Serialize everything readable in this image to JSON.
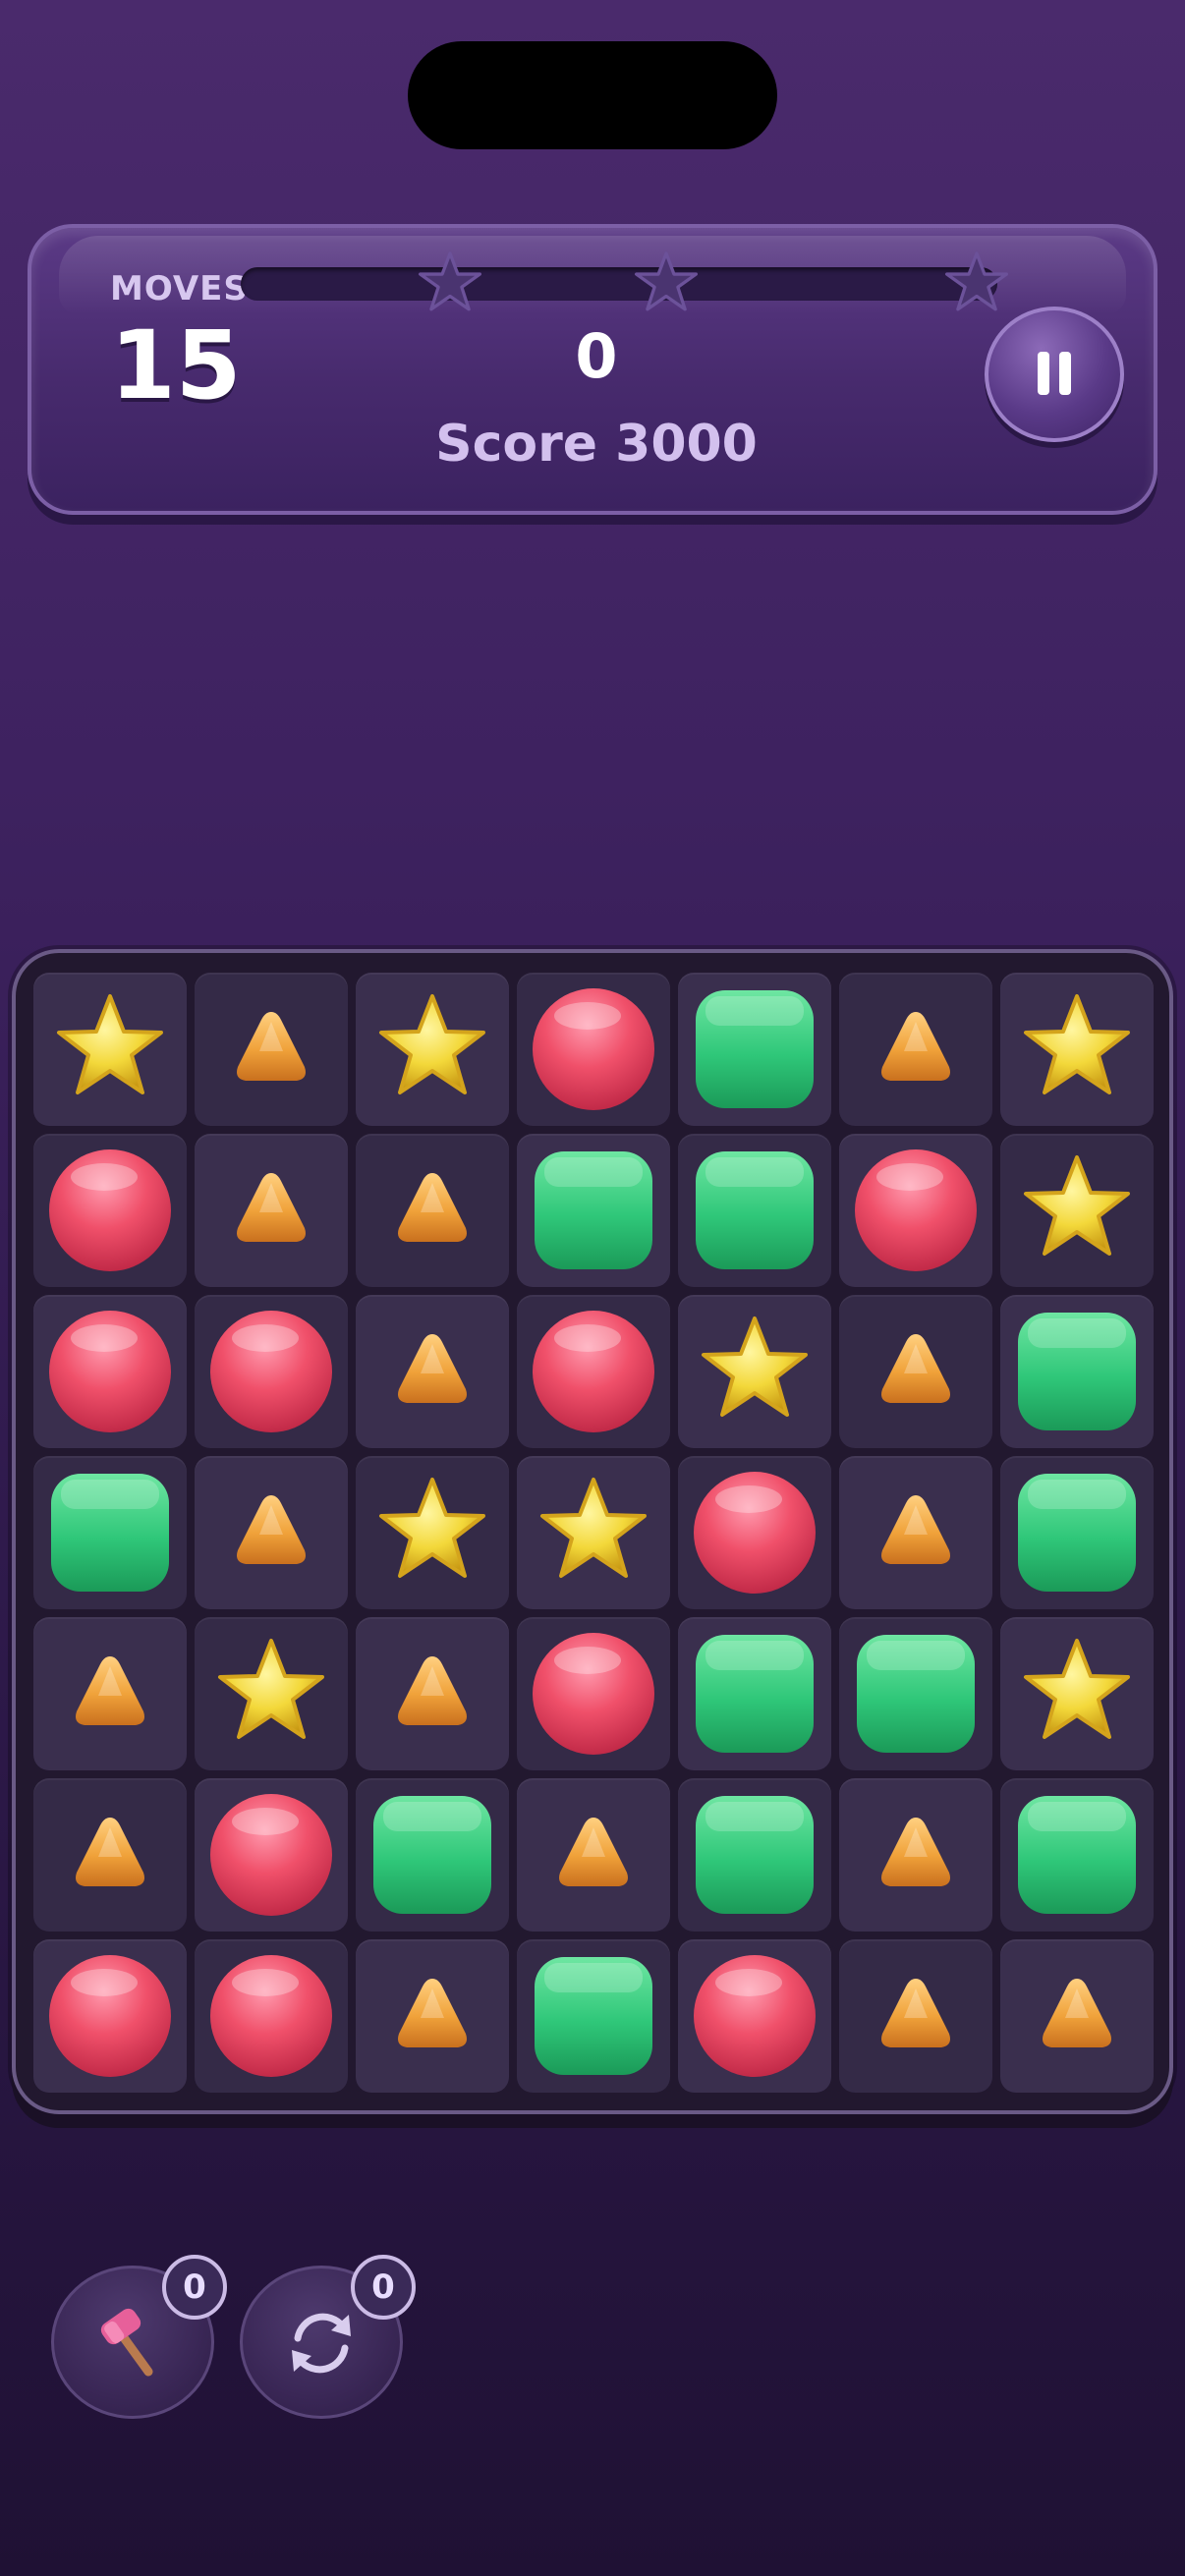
{
  "hud": {
    "moves_label": "MOVES",
    "moves_value": "15",
    "score_value": "0",
    "score_label": "Score 3000",
    "progress_fraction": 0,
    "stars_earned": 0,
    "stars_total": 3
  },
  "board": {
    "rows": 7,
    "cols": 7,
    "cells": [
      [
        "star",
        "triangle",
        "star",
        "circle",
        "square",
        "triangle",
        "star"
      ],
      [
        "circle",
        "triangle",
        "triangle",
        "square",
        "square",
        "circle",
        "star"
      ],
      [
        "circle",
        "circle",
        "triangle",
        "circle",
        "star",
        "triangle",
        "square"
      ],
      [
        "square",
        "triangle",
        "star",
        "star",
        "circle",
        "triangle",
        "square"
      ],
      [
        "triangle",
        "star",
        "triangle",
        "circle",
        "square",
        "square",
        "star"
      ],
      [
        "triangle",
        "circle",
        "square",
        "triangle",
        "square",
        "triangle",
        "square"
      ],
      [
        "circle",
        "circle",
        "triangle",
        "square",
        "circle",
        "triangle",
        "triangle"
      ]
    ]
  },
  "boosters": [
    {
      "icon": "hammer-icon",
      "count": "0"
    },
    {
      "icon": "shuffle-icon",
      "count": "0"
    }
  ],
  "colors": {
    "star": "#f3d83a",
    "triangle": "#f0a23a",
    "circle": "#f0506a",
    "square": "#2fc779",
    "background": "#3e2260"
  }
}
